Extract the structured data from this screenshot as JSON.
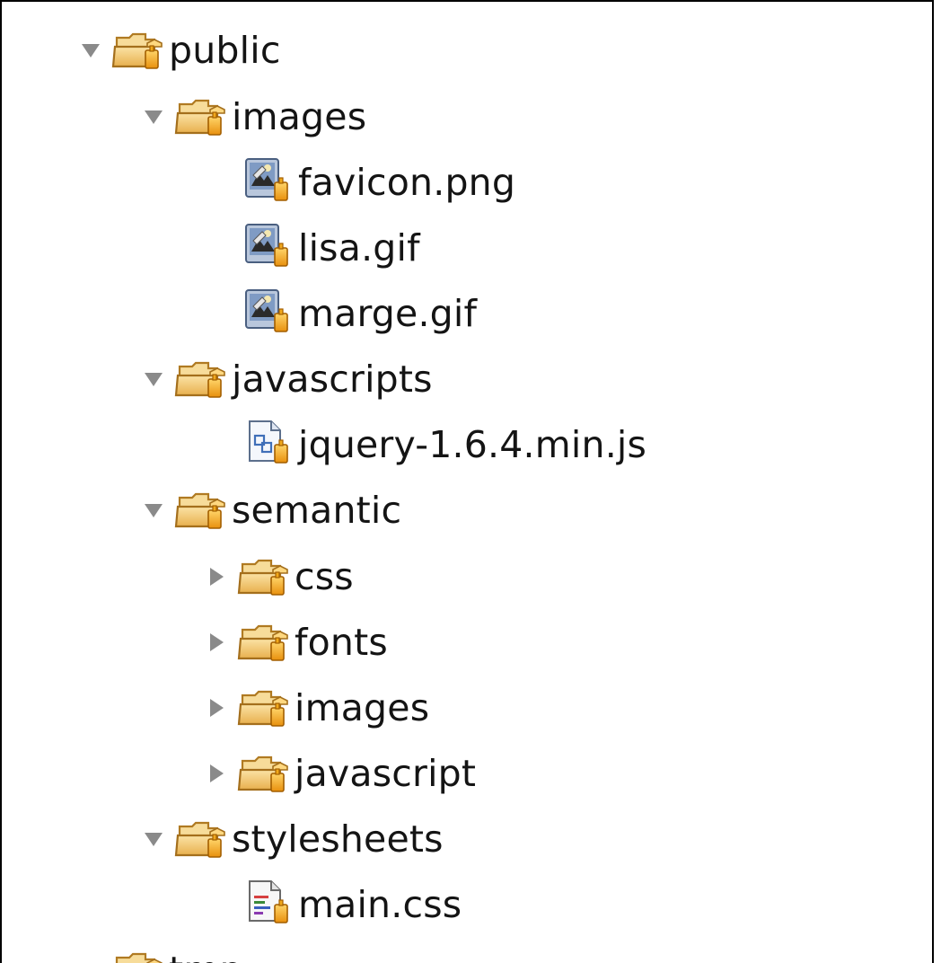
{
  "tree": {
    "items": [
      {
        "label": "public",
        "type": "folder",
        "state": "expanded"
      },
      {
        "label": "images",
        "type": "folder",
        "state": "expanded"
      },
      {
        "label": "favicon.png",
        "type": "image-file"
      },
      {
        "label": "lisa.gif",
        "type": "image-file"
      },
      {
        "label": "marge.gif",
        "type": "image-file"
      },
      {
        "label": "javascripts",
        "type": "folder",
        "state": "expanded"
      },
      {
        "label": "jquery-1.6.4.min.js",
        "type": "js-file"
      },
      {
        "label": "semantic",
        "type": "folder",
        "state": "expanded"
      },
      {
        "label": "css",
        "type": "folder",
        "state": "collapsed"
      },
      {
        "label": "fonts",
        "type": "folder",
        "state": "collapsed"
      },
      {
        "label": "images",
        "type": "folder",
        "state": "collapsed"
      },
      {
        "label": "javascript",
        "type": "folder",
        "state": "collapsed"
      },
      {
        "label": "stylesheets",
        "type": "folder",
        "state": "expanded"
      },
      {
        "label": "main.css",
        "type": "css-file"
      },
      {
        "label": "tmp",
        "type": "folder"
      }
    ]
  },
  "icons": {
    "folder": "open-folder-icon",
    "image-file": "image-file-icon",
    "js-file": "javascript-file-icon",
    "css-file": "css-file-icon",
    "expanded": "triangle-down-icon",
    "collapsed": "triangle-right-icon"
  },
  "colors": {
    "folder_fill": "#f2c76b",
    "folder_stroke": "#b07a22",
    "lock_badge": "#f0a81c",
    "twisty": "#8a8a8a",
    "text": "#141414"
  }
}
